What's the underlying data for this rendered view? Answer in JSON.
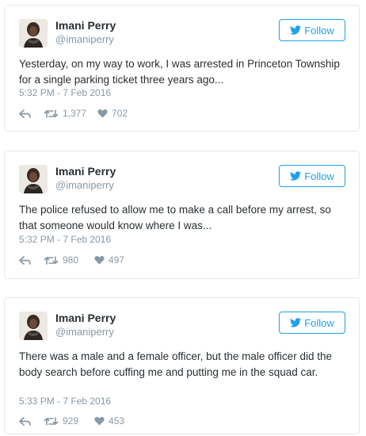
{
  "tweets": [
    {
      "author_name": "Imani Perry",
      "handle": "@imaniperry",
      "follow_label": "Follow",
      "text": "Yesterday, on my way to work, I was arrested in Princeton Township for a single parking ticket three years ago...",
      "timestamp": "5:32 PM - 7 Feb 2016",
      "retweets": "1,377",
      "likes": "702"
    },
    {
      "author_name": "Imani Perry",
      "handle": "@imaniperry",
      "follow_label": "Follow",
      "text": "The police refused to allow me to make a call before my arrest, so that someone would know where I was...",
      "timestamp": "5:32 PM - 7 Feb 2016",
      "retweets": "980",
      "likes": "497"
    },
    {
      "author_name": "Imani Perry",
      "handle": "@imaniperry",
      "follow_label": "Follow",
      "text": "There was a male and a female officer, but the male officer did the body search before cuffing me and putting me in the squad car.",
      "timestamp": "5:33 PM - 7 Feb 2016",
      "retweets": "929",
      "likes": "453"
    }
  ],
  "icons": {
    "bird": "twitter-bird-icon",
    "reply": "reply-icon",
    "retweet": "retweet-icon",
    "like": "heart-icon"
  },
  "colors": {
    "accent": "#1da1f2",
    "muted": "#8899a6",
    "text": "#292f33",
    "border": "#e1e8ed"
  }
}
